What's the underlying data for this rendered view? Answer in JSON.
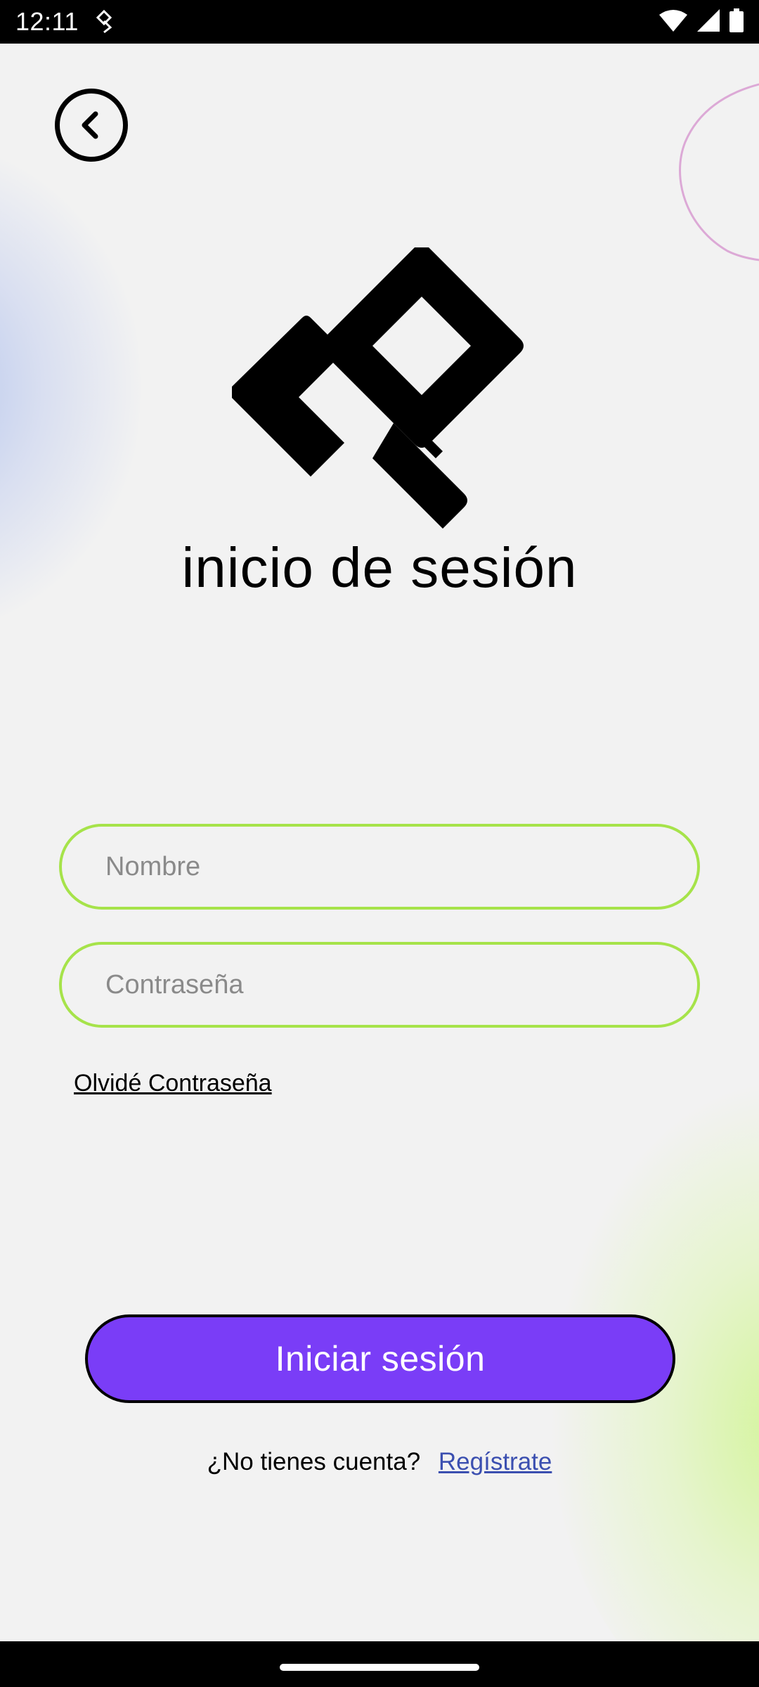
{
  "status_bar": {
    "time": "12:11",
    "icons": [
      "data-saver-icon",
      "wifi-icon",
      "signal-icon",
      "battery-icon"
    ]
  },
  "header": {
    "back_icon": "chevron-left-icon"
  },
  "logo": {
    "icon": "diamond-logo"
  },
  "title": "inicio de sesión",
  "form": {
    "name_placeholder": "Nombre",
    "name_value": "",
    "password_placeholder": "Contraseña",
    "password_value": "",
    "forgot_label": "Olvidé Contraseña"
  },
  "actions": {
    "login_label": "Iniciar sesión",
    "no_account_text": "¿No tienes cuenta?",
    "register_label": "Regístrate"
  },
  "colors": {
    "background": "#f2f2f2",
    "accent": "#7a3df7",
    "field_border": "#a6e34a",
    "link": "#3b4fb0"
  }
}
